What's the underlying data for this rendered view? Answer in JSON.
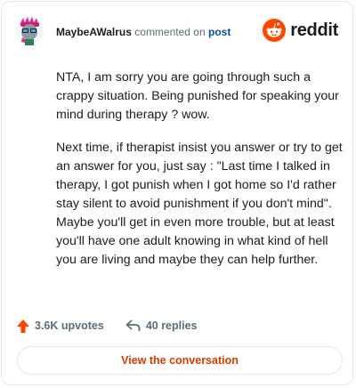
{
  "comment": {
    "username": "MaybeAWalrus",
    "commented_text": "commented on",
    "post_link": "post",
    "brand": "reddit",
    "paragraphs": [
      "NTA, I am sorry you are going through such a crappy situation. Being punished for speaking your mind during therapy ? wow.",
      "Next time, if therapist insist you answer or try to get an answer for you, just say : \"Last time I talked in therapy, I got punish when I got home so I'd rather stay silent to avoid punishment if you don't mind\". Maybe you'll get in even more trouble, but at least you'll have one adult knowing in what kind of hell you are living and maybe they can help further."
    ],
    "upvotes": "3.6K upvotes",
    "replies": "40 replies",
    "cta": "View the conversation"
  },
  "colors": {
    "brand_orange": "#ff4500",
    "cta_text": "#d93a00",
    "link_blue": "#0a4fa8"
  },
  "icons": [
    "avatar",
    "reddit-logo-icon",
    "upvote-arrow-icon",
    "reply-arrow-icon"
  ]
}
